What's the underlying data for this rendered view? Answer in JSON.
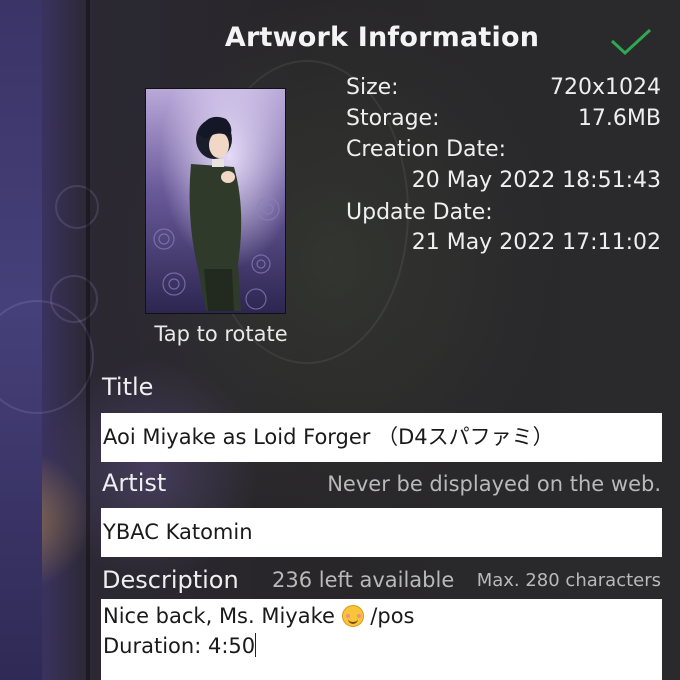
{
  "dialog": {
    "title": "Artwork Information",
    "confirm_icon": "check-icon",
    "accent_color": "#2fa84f"
  },
  "thumbnail": {
    "tap_label": "Tap to rotate"
  },
  "info": {
    "size_label": "Size:",
    "size_value": "720x1024",
    "storage_label": "Storage:",
    "storage_value": "17.6MB",
    "creation_label": "Creation Date:",
    "creation_value": "20 May 2022 18:51:43",
    "update_label": "Update Date:",
    "update_value": "21 May 2022 17:11:02"
  },
  "fields": {
    "title_label": "Title",
    "title_value": "Aoi Miyake as Loid Forger （D4スパファミ）",
    "artist_label": "Artist",
    "artist_hint": "Never be displayed on the web.",
    "artist_value": "YBAC Katomin",
    "description_label": "Description",
    "description_remaining": "236 left available",
    "description_max": "Max. 280 characters",
    "description_line1_before": "Nice back, Ms. Miyake ",
    "description_emoji": "smiling-face-icon",
    "description_line1_after": " /pos",
    "description_line2": "Duration: 4:50"
  }
}
